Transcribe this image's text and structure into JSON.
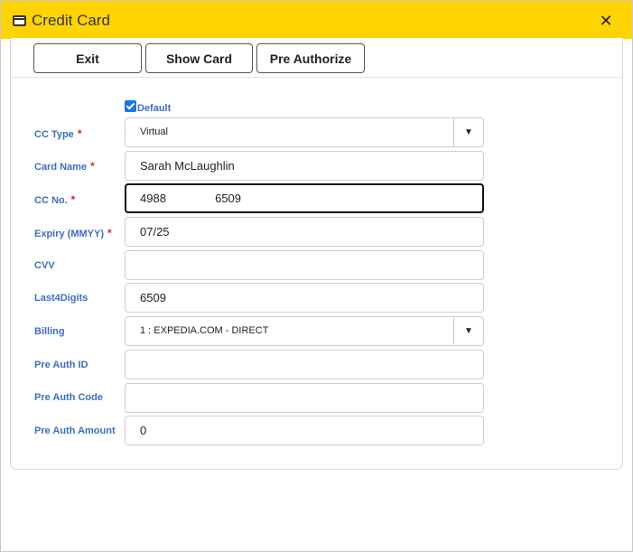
{
  "window": {
    "title": "Credit Card"
  },
  "toolbar": {
    "exit_label": "Exit",
    "show_card_label": "Show Card",
    "pre_authorize_label": "Pre Authorize"
  },
  "form": {
    "default_label": "Default",
    "default_checked": true,
    "required_marker": "*",
    "cc_type": {
      "label": "CC Type",
      "value": "Virtual"
    },
    "card_name": {
      "label": "Card Name",
      "value": "Sarah McLaughlin"
    },
    "cc_no": {
      "label": "CC No.",
      "value": "4988               6509"
    },
    "expiry": {
      "label": "Expiry (MMYY)",
      "value": "07/25"
    },
    "cvv": {
      "label": "CVV",
      "value": ""
    },
    "last4": {
      "label": "Last4Digits",
      "value": "6509"
    },
    "billing": {
      "label": "Billing",
      "value": "1 : EXPEDIA.COM - DIRECT"
    },
    "pre_auth_id": {
      "label": "Pre Auth ID",
      "value": ""
    },
    "pre_auth_code": {
      "label": "Pre Auth Code",
      "value": ""
    },
    "pre_auth_amount": {
      "label": "Pre Auth Amount",
      "value": "0"
    }
  },
  "colors": {
    "titlebar": "#ffd400",
    "label": "#3b6ec4",
    "required": "#e02020",
    "checkbox": "#1a73e8"
  },
  "icons": {
    "window_icon": "credit-card-icon",
    "close": "close-icon",
    "dropdown": "chevron-down-icon"
  }
}
